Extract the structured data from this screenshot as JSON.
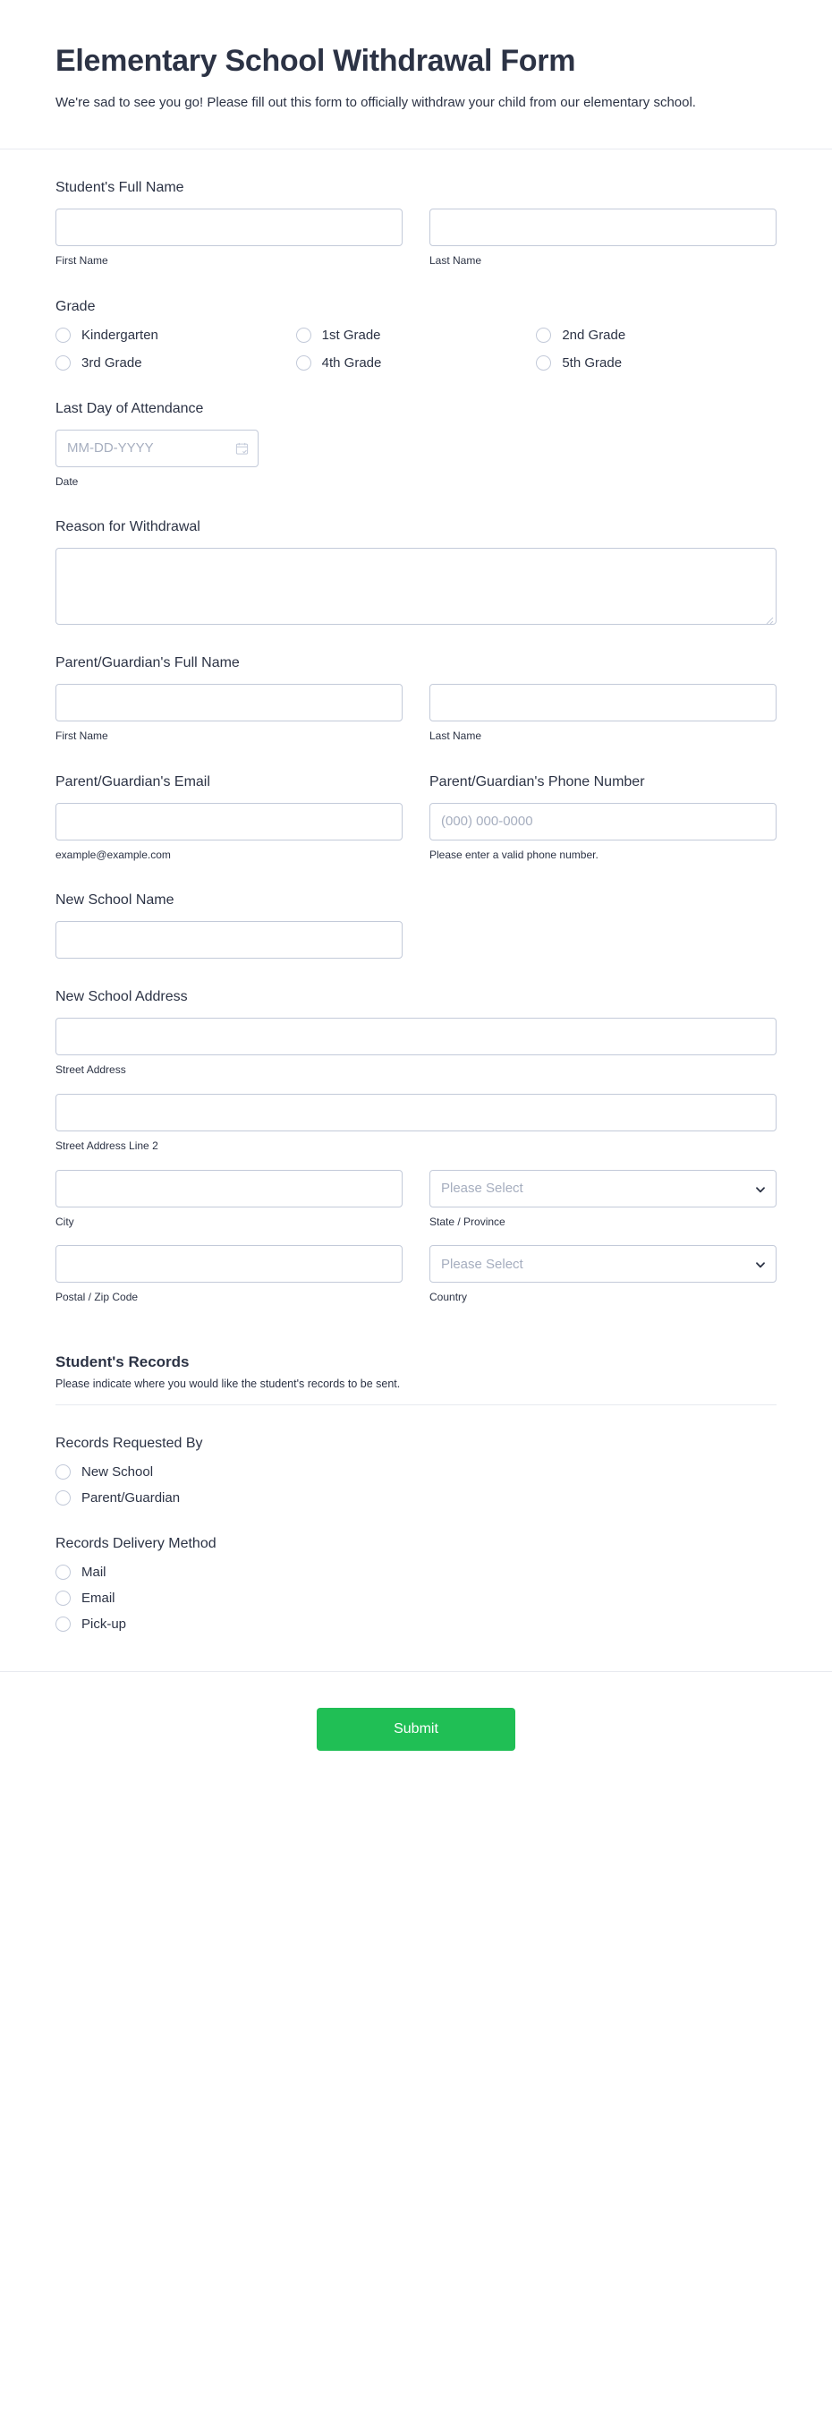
{
  "header": {
    "title": "Elementary School Withdrawal Form",
    "subtitle": "We're sad to see you go! Please fill out this form to officially withdraw your child from our elementary school."
  },
  "fields": {
    "student_name": {
      "label": "Student's Full Name",
      "first": {
        "value": "",
        "placeholder": "",
        "sublabel": "First Name"
      },
      "last": {
        "value": "",
        "placeholder": "",
        "sublabel": "Last Name"
      }
    },
    "grade": {
      "label": "Grade",
      "options": [
        "Kindergarten",
        "1st Grade",
        "2nd Grade",
        "3rd Grade",
        "4th Grade",
        "5th Grade"
      ],
      "selected": null
    },
    "last_day": {
      "label": "Last Day of Attendance",
      "value": "",
      "placeholder": "MM-DD-YYYY",
      "sublabel": "Date",
      "icon": "calendar-icon"
    },
    "reason": {
      "label": "Reason for Withdrawal",
      "value": "",
      "placeholder": ""
    },
    "parent_name": {
      "label": "Parent/Guardian's Full Name",
      "first": {
        "value": "",
        "placeholder": "",
        "sublabel": "First Name"
      },
      "last": {
        "value": "",
        "placeholder": "",
        "sublabel": "Last Name"
      }
    },
    "parent_email": {
      "label": "Parent/Guardian's Email",
      "value": "",
      "placeholder": "",
      "sublabel": "example@example.com"
    },
    "parent_phone": {
      "label": "Parent/Guardian's Phone Number",
      "value": "",
      "placeholder": "(000) 000-0000",
      "sublabel": "Please enter a valid phone number."
    },
    "new_school_name": {
      "label": "New School Name",
      "value": "",
      "placeholder": ""
    },
    "new_school_address": {
      "label": "New School Address",
      "street": {
        "value": "",
        "placeholder": "",
        "sublabel": "Street Address"
      },
      "street2": {
        "value": "",
        "placeholder": "",
        "sublabel": "Street Address Line 2"
      },
      "city": {
        "value": "",
        "placeholder": "",
        "sublabel": "City"
      },
      "state": {
        "value": "Please Select",
        "sublabel": "State / Province",
        "icon": "chevron-down-icon"
      },
      "postal": {
        "value": "",
        "placeholder": "",
        "sublabel": "Postal / Zip Code"
      },
      "country": {
        "value": "Please Select",
        "sublabel": "Country",
        "icon": "chevron-down-icon"
      }
    }
  },
  "records_section": {
    "title": "Student's Records",
    "subtitle": "Please indicate where you would like the student's records to be sent.",
    "requested_by": {
      "label": "Records Requested By",
      "options": [
        "New School",
        "Parent/Guardian"
      ],
      "selected": null
    },
    "delivery_method": {
      "label": "Records Delivery Method",
      "options": [
        "Mail",
        "Email",
        "Pick-up"
      ],
      "selected": null
    }
  },
  "footer": {
    "submit_label": "Submit"
  },
  "colors": {
    "submit_green": "#20bf55",
    "text_dark": "#2c3345",
    "border": "#c3cad9",
    "placeholder": "#a6aebf"
  }
}
